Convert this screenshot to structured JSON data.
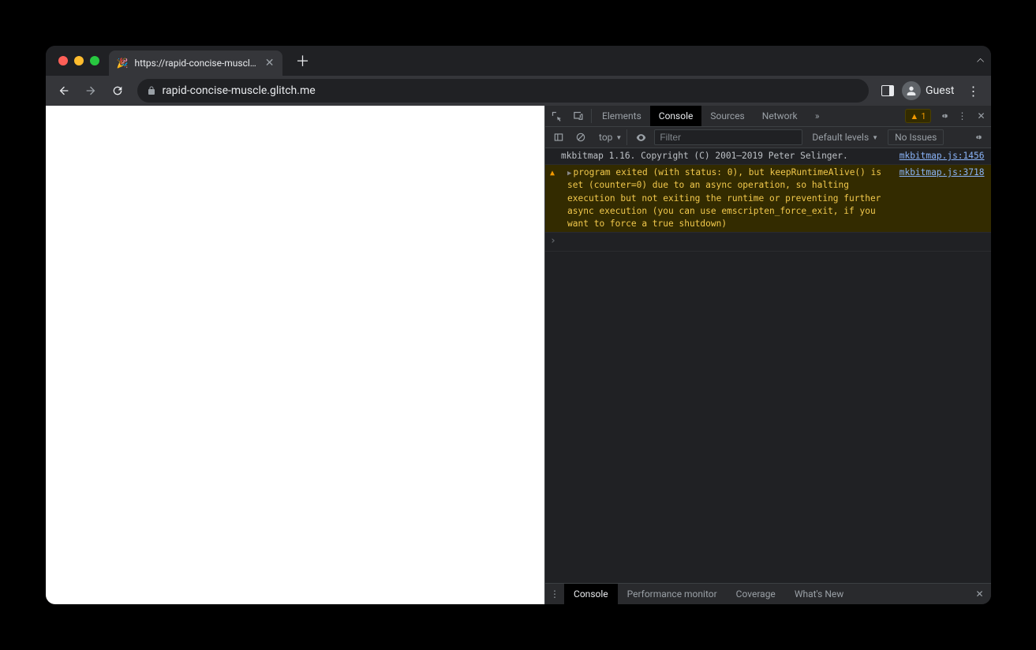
{
  "tab": {
    "favicon": "🎉",
    "title": "https://rapid-concise-muscle.g"
  },
  "omnibox": {
    "url": "rapid-concise-muscle.glitch.me"
  },
  "toolbar": {
    "guest_label": "Guest"
  },
  "devtools": {
    "tabs": {
      "elements": "Elements",
      "console": "Console",
      "sources": "Sources",
      "network": "Network"
    },
    "warn_count": "1",
    "console_toolbar": {
      "context": "top",
      "filter_placeholder": "Filter",
      "levels": "Default levels",
      "issues": "No Issues"
    },
    "messages": {
      "log": {
        "text": "mkbitmap 1.16. Copyright (C) 2001–2019 Peter Selinger.",
        "src": "mkbitmap.js:1456"
      },
      "warn": {
        "text": "program exited (with status: 0), but keepRuntimeAlive() is set (counter=0) due to an async operation, so halting execution but not exiting the runtime or preventing further async execution (you can use emscripten_force_exit, if you want to force a true shutdown)",
        "src": "mkbitmap.js:3718"
      }
    },
    "drawer": {
      "console": "Console",
      "perfmon": "Performance monitor",
      "coverage": "Coverage",
      "whatsnew": "What's New"
    }
  }
}
